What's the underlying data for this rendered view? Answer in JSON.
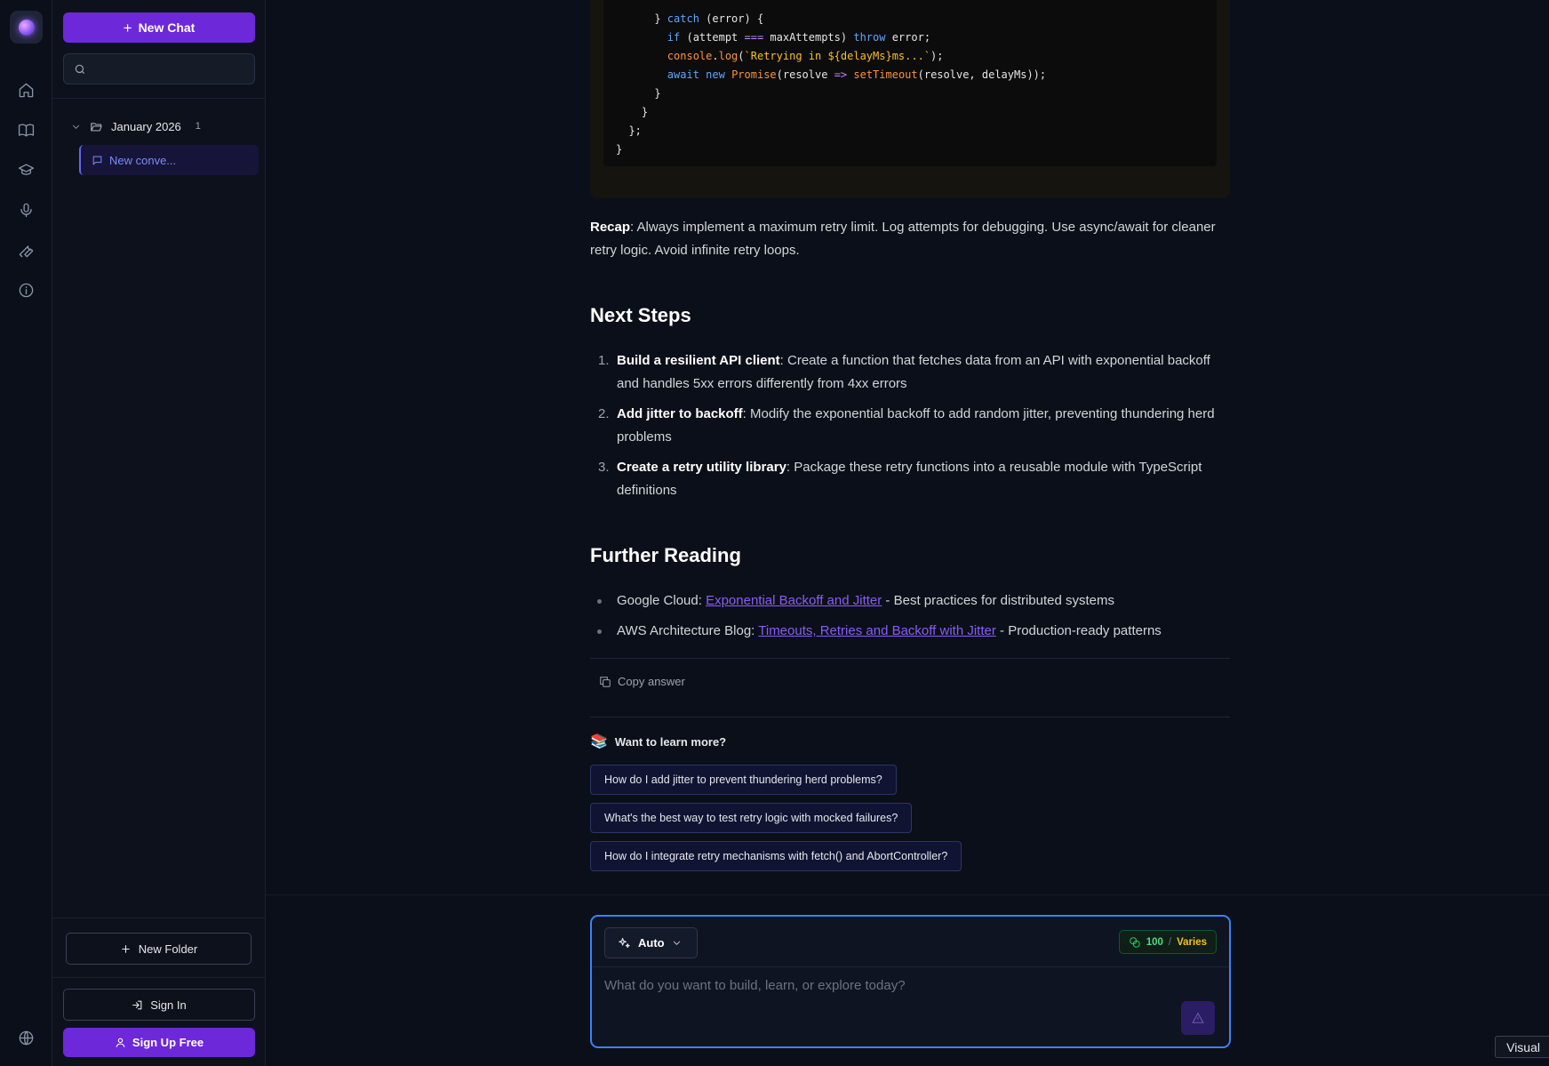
{
  "sidebar": {
    "new_chat_label": "New Chat",
    "search_placeholder": "",
    "folder": {
      "label": "January 2026",
      "count": "1"
    },
    "conversation": {
      "label": "New conve..."
    },
    "new_folder_label": "New Folder",
    "sign_in_label": "Sign In",
    "sign_up_label": "Sign Up Free"
  },
  "rail": {
    "icons": [
      "logo-icon",
      "home-icon",
      "book-icon",
      "graduation-cap-icon",
      "microphone-icon",
      "wrench-icon",
      "info-icon",
      "globe-icon"
    ]
  },
  "code": {
    "lines": [
      "      } catch (error) {",
      "        if (attempt === maxAttempts) throw error;",
      "        console.log(`Retrying in ${delayMs}ms...`);",
      "        await new Promise(resolve => setTimeout(resolve, delayMs));",
      "      }",
      "    }",
      "  };",
      "}"
    ]
  },
  "recap": {
    "label": "Recap",
    "text": ": Always implement a maximum retry limit. Log attempts for debugging. Use async/await for cleaner retry logic. Avoid infinite retry loops."
  },
  "next_steps": {
    "heading": "Next Steps",
    "items": [
      {
        "num": "1.",
        "title": "Build a resilient API client",
        "text": ": Create a function that fetches data from an API with exponential backoff and handles 5xx errors differently from 4xx errors"
      },
      {
        "num": "2.",
        "title": "Add jitter to backoff",
        "text": ": Modify the exponential backoff to add random jitter, preventing thundering herd problems"
      },
      {
        "num": "3.",
        "title": "Create a retry utility library",
        "text": ": Package these retry functions into a reusable module with TypeScript definitions"
      }
    ]
  },
  "further_reading": {
    "heading": "Further Reading",
    "items": [
      {
        "prefix": "Google Cloud: ",
        "link": "Exponential Backoff and Jitter",
        "suffix": " - Best practices for distributed systems"
      },
      {
        "prefix": "AWS Architecture Blog: ",
        "link": "Timeouts, Retries and Backoff with Jitter",
        "suffix": " - Production-ready patterns"
      }
    ]
  },
  "copy_answer_label": "Copy answer",
  "learn_more": {
    "title": "Want to learn more?",
    "suggestions": [
      "How do I add jitter to prevent thundering herd problems?",
      "What's the best way to test retry logic with mocked failures?",
      "How do I integrate retry mechanisms with fetch() and AbortController?"
    ]
  },
  "composer": {
    "mode_label": "Auto",
    "credits_value": "100",
    "credits_sep": "/",
    "credits_cost": "Varies",
    "placeholder": "What do you want to build, learn, or explore today?"
  },
  "visual_tag": "Visual",
  "colors": {
    "accent": "#6d28d9",
    "link": "#8b5cf6",
    "composer_border": "#3b82f6",
    "credits_green": "#4ade80",
    "credits_amber": "#fbbf24"
  }
}
